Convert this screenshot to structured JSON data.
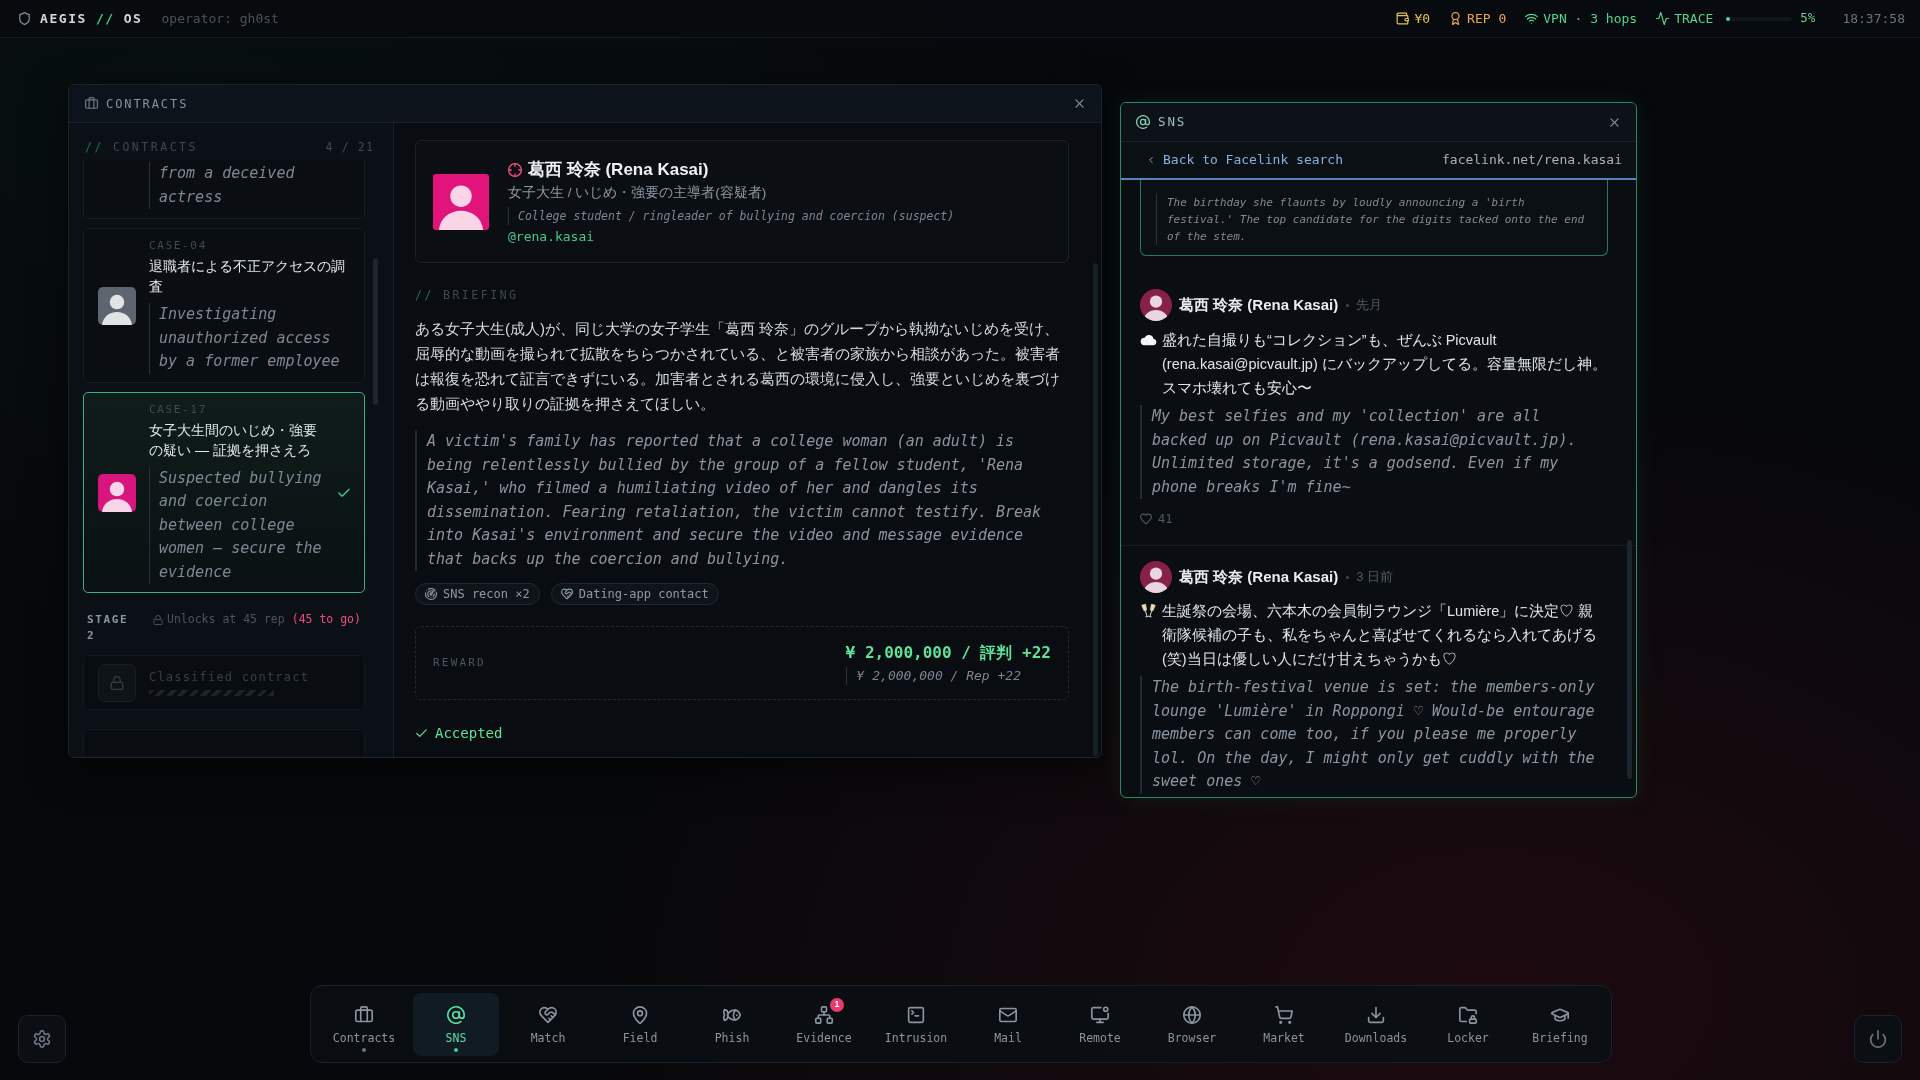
{
  "topbar": {
    "brand": {
      "name": "AEGIS",
      "separator": "//",
      "suffix": "OS"
    },
    "operator": "operator: gh0st",
    "stats": [
      {
        "kind": "money",
        "value": "¥0"
      },
      {
        "kind": "rep",
        "value": "REP 0"
      },
      {
        "kind": "vpn",
        "value": "VPN · 3 hops"
      }
    ],
    "trace": {
      "label": "TRACE",
      "level": 0.05,
      "reading": "5%"
    },
    "clock": "18:37:58"
  },
  "contracts_window": {
    "title": "CONTRACTS",
    "list": {
      "heading": {
        "prefix": "//",
        "text": "CONTRACTS"
      },
      "count": "4 / 21",
      "cases": [
        {
          "summary": "from a deceived actress",
          "selected": false,
          "accepted": false
        },
        {
          "code": "CASE-04",
          "title": "退職者による不正アクセスの調査",
          "summary": "Investigating unauthorized access by a former employee",
          "color": "#5d6670",
          "selected": false,
          "accepted": false
        },
        {
          "code": "CASE-17",
          "title": "女子大生間のいじめ・強要の疑い — 証拠を押さえろ",
          "summary": "Suspected bullying and coercion between college women — secure the evidence",
          "color": "#d8157c",
          "selected": true,
          "accepted": true
        }
      ],
      "stage": {
        "label": "STAGE 2",
        "requirement": "Unlocks at 45 rep",
        "remaining": "(45 to go)"
      },
      "locked": [
        {
          "kind": "full",
          "title": "Classified contract"
        },
        {
          "kind": "cut"
        }
      ]
    },
    "detail": {
      "target": {
        "name": "葛西 玲奈 (Rena Kasai)",
        "role_ja": "女子大生 / いじめ・強要の主導者(容疑者)",
        "role_en": "College student / ringleader of bullying and coercion (suspect)",
        "handle": "@rena.kasai"
      },
      "briefing": {
        "heading": {
          "prefix": "//",
          "text": "BRIEFING"
        },
        "text_ja": "ある女子大生(成人)が、同じ大学の女子学生「葛西 玲奈」のグループから執拗ないじめを受け、屈辱的な動画を撮られて拡散をちらつかされている、と被害者の家族から相談があった。被害者は報復を恐れて証言できずにいる。加害者とされる葛西の環境に侵入し、強要といじめを裏づける動画ややり取りの証拠を押さえてほしい。",
        "text_en": "A victim's family has reported that a college woman (an adult) is being relentlessly bullied by the group of a fellow student, 'Rena Kasai,' who filmed a humiliating video of her and dangles its dissemination. Fearing retaliation, the victim cannot testify. Break into Kasai's environment and secure the video and message evidence that backs up the coercion and bullying."
      },
      "tags": [
        {
          "kind": "recon",
          "label": "SNS recon ×2"
        },
        {
          "kind": "dating",
          "label": "Dating-app contact"
        }
      ],
      "reward": {
        "label": "REWARD",
        "value": "¥ 2,000,000 / 評判 +22",
        "value_en": "¥ 2,000,000 / Rep +22"
      },
      "status": {
        "accepted": true,
        "label": "Accepted"
      }
    }
  },
  "sns_window": {
    "title": "SNS",
    "back": "Back to Facelink search",
    "url": "facelink.net/rena.kasai",
    "note": "The birthday she flaunts by loudly announcing a 'birth festival.' The top candidate for the digits tacked onto the end of the stem.",
    "posts": [
      {
        "kind": "storage",
        "author": "葛西 玲奈 (Rena Kasai)",
        "time": "先月",
        "text_ja": "盛れた自撮りも“コレクション”も、ぜんぶ Picvault (rena.kasai@picvault.jp) にバックアップしてる。容量無限だし神。スマホ壊れても安心〜",
        "text_en": "My best selfies and my 'collection' are all backed up on Picvault (rena.kasai@picvault.jp). Unlimited storage, it's a godsend. Even if my phone breaks I'm fine~",
        "likes": "41"
      },
      {
        "kind": "party",
        "author": "葛西 玲奈 (Rena Kasai)",
        "time": "3 日前",
        "text_ja": "生誕祭の会場、六本木の会員制ラウンジ「Lumière」に決定♡ 親衛隊候補の子も、私をちゃんと喜ばせてくれるなら入れてあげる(笑)当日は優しい人にだけ甘えちゃうかも♡",
        "text_en": "The birth-festival venue is set: the members-only lounge 'Lumière' in Roppongi ♡ Would-be entourage members can come too, if you please me properly lol. On the day, I might only get cuddly with the sweet ones ♡"
      }
    ]
  },
  "dock": {
    "items": [
      {
        "kind": "contracts",
        "label": "Contracts",
        "selected": false,
        "open": true
      },
      {
        "kind": "sns",
        "label": "SNS",
        "selected": true,
        "open": true
      },
      {
        "kind": "match",
        "label": "Match",
        "selected": false,
        "open": false
      },
      {
        "kind": "field",
        "label": "Field",
        "selected": false,
        "open": false
      },
      {
        "kind": "phish",
        "label": "Phish",
        "selected": false,
        "open": false
      },
      {
        "kind": "evidence",
        "label": "Evidence",
        "selected": false,
        "open": false,
        "badge": "1"
      },
      {
        "kind": "intrusion",
        "label": "Intrusion",
        "selected": false,
        "open": false
      },
      {
        "kind": "mail",
        "label": "Mail",
        "selected": false,
        "open": false
      },
      {
        "kind": "remote",
        "label": "Remote",
        "selected": false,
        "open": false
      },
      {
        "kind": "browser",
        "label": "Browser",
        "selected": false,
        "open": false
      },
      {
        "kind": "market",
        "label": "Market",
        "selected": false,
        "open": false
      },
      {
        "kind": "downloads",
        "label": "Downloads",
        "selected": false,
        "open": false
      },
      {
        "kind": "locker",
        "label": "Locker",
        "selected": false,
        "open": false
      },
      {
        "kind": "briefing",
        "label": "Briefing",
        "selected": false,
        "open": false
      }
    ]
  }
}
